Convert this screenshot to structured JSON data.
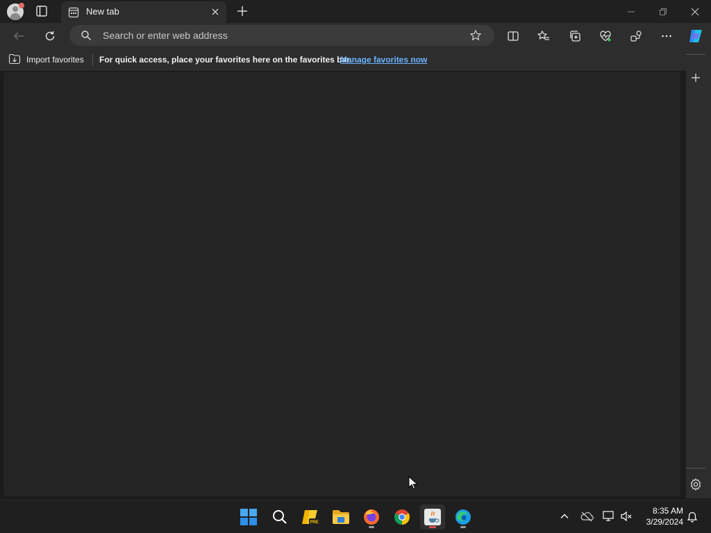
{
  "browser": {
    "tab_title": "New tab",
    "address_placeholder": "Search or enter web address",
    "favorites_bar": {
      "import_label": "Import favorites",
      "message": "For quick access, place your favorites here on the favorites bar.",
      "manage_link": "Manage favorites now"
    },
    "colors": {
      "titlebar": "#202020",
      "toolbar": "#2d2d2d",
      "content": "#242424",
      "link": "#6cb4ff"
    }
  },
  "taskbar": {
    "apps": [
      "start-icon",
      "search-icon",
      "pre-release-app-icon",
      "file-explorer-icon",
      "firefox-icon",
      "chrome-icon",
      "java-app-icon",
      "edge-icon"
    ],
    "clock": {
      "time": "8:35 AM",
      "date": "3/29/2024"
    }
  }
}
